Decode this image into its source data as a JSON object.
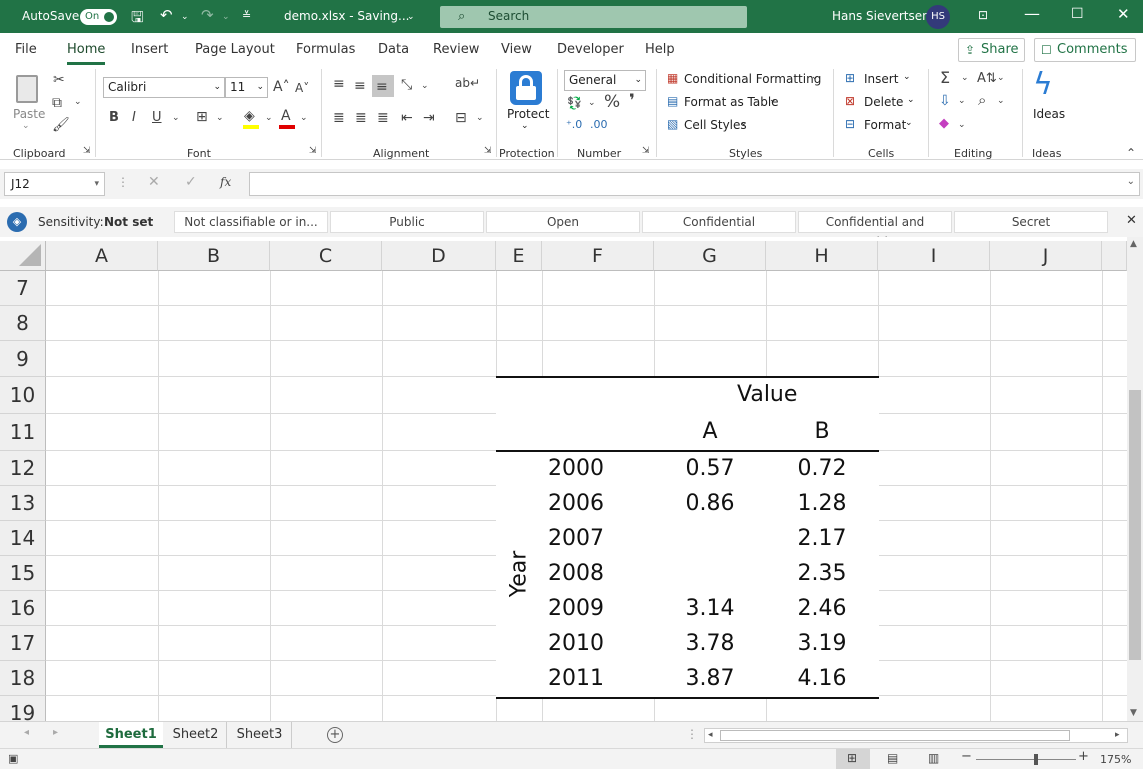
{
  "titlebar": {
    "autosave_label": "AutoSave",
    "autosave_state": "On",
    "filename": "demo.xlsx  -  Saving...",
    "search_placeholder": "Search",
    "user_name": "Hans Sievertsen",
    "user_initials": "HS"
  },
  "menu": {
    "tabs": [
      "File",
      "Home",
      "Insert",
      "Page Layout",
      "Formulas",
      "Data",
      "Review",
      "View",
      "Developer",
      "Help"
    ],
    "active": "Home",
    "share_label": "Share",
    "comments_label": "Comments"
  },
  "ribbon": {
    "clipboard": {
      "paste_label": "Paste",
      "group_label": "Clipboard"
    },
    "font": {
      "name": "Calibri",
      "size": "11",
      "bold": "B",
      "italic": "I",
      "underline": "U",
      "group_label": "Font"
    },
    "alignment": {
      "group_label": "Alignment"
    },
    "protection": {
      "protect_label": "Protect",
      "group_label": "Protection"
    },
    "number": {
      "format": "General",
      "group_label": "Number"
    },
    "styles": {
      "conditional_formatting": "Conditional Formatting",
      "format_as_table": "Format as Table",
      "cell_styles": "Cell Styles",
      "group_label": "Styles"
    },
    "cells": {
      "insert": "Insert",
      "delete": "Delete",
      "format": "Format",
      "group_label": "Cells"
    },
    "editing": {
      "group_label": "Editing"
    },
    "ideas": {
      "label": "Ideas",
      "group_label": "Ideas"
    }
  },
  "formula_bar": {
    "name_box": "J12",
    "fx": "fx",
    "formula": ""
  },
  "sensitivity": {
    "label": "Sensitivity:",
    "value": "Not set",
    "options": [
      "Not classifiable or in...",
      "Public",
      "Open",
      "Confidential",
      "Confidential and Sensitive",
      "Secret"
    ]
  },
  "grid": {
    "columns": [
      "A",
      "B",
      "C",
      "D",
      "E",
      "F",
      "G",
      "H",
      "I",
      "J"
    ],
    "rows": [
      "7",
      "8",
      "9",
      "10",
      "11",
      "12",
      "13",
      "14",
      "15",
      "16",
      "17",
      "18",
      "19"
    ],
    "table": {
      "value_header": "Value",
      "col_headers": [
        "A",
        "B"
      ],
      "row_group_label": "Year",
      "rows": [
        {
          "year": "2000",
          "a": "0.57",
          "b": "0.72"
        },
        {
          "year": "2006",
          "a": "0.86",
          "b": "1.28"
        },
        {
          "year": "2007",
          "a": "",
          "b": "2.17"
        },
        {
          "year": "2008",
          "a": "",
          "b": "2.35"
        },
        {
          "year": "2009",
          "a": "3.14",
          "b": "2.46"
        },
        {
          "year": "2010",
          "a": "3.78",
          "b": "3.19"
        },
        {
          "year": "2011",
          "a": "3.87",
          "b": "4.16"
        }
      ]
    }
  },
  "sheets": {
    "tabs": [
      "Sheet1",
      "Sheet2",
      "Sheet3"
    ],
    "active": "Sheet1"
  },
  "status": {
    "zoom": "175%"
  },
  "colors": {
    "excel_green": "#217346",
    "avatar": "#333a7a"
  }
}
